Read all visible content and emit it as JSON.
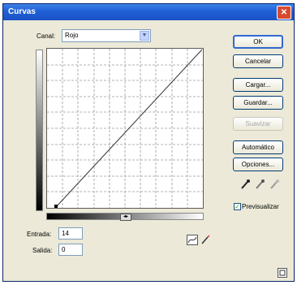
{
  "window": {
    "title": "Curvas",
    "close_glyph": "✕"
  },
  "channel": {
    "label": "Canal:",
    "value": "Rojo"
  },
  "buttons": {
    "ok": "OK",
    "cancel": "Cancelar",
    "load": "Cargar...",
    "save": "Guardar...",
    "smooth": "Suavizar",
    "auto": "Automático",
    "options": "Opciones..."
  },
  "preview": {
    "label": "Previsualizar",
    "checked": true
  },
  "input": {
    "label": "Entrada:",
    "value": "14"
  },
  "output": {
    "label": "Salida:",
    "value": "0"
  },
  "icons": [
    "chevron-down-icon",
    "eyedropper-black-icon",
    "eyedropper-gray-icon",
    "eyedropper-white-icon",
    "curve-tool-icon",
    "pencil-icon",
    "expand-icon"
  ],
  "colors": {
    "titlebar": "#1f5fd6",
    "dialog": "#ece9d8",
    "default_border": "#3068d4"
  }
}
